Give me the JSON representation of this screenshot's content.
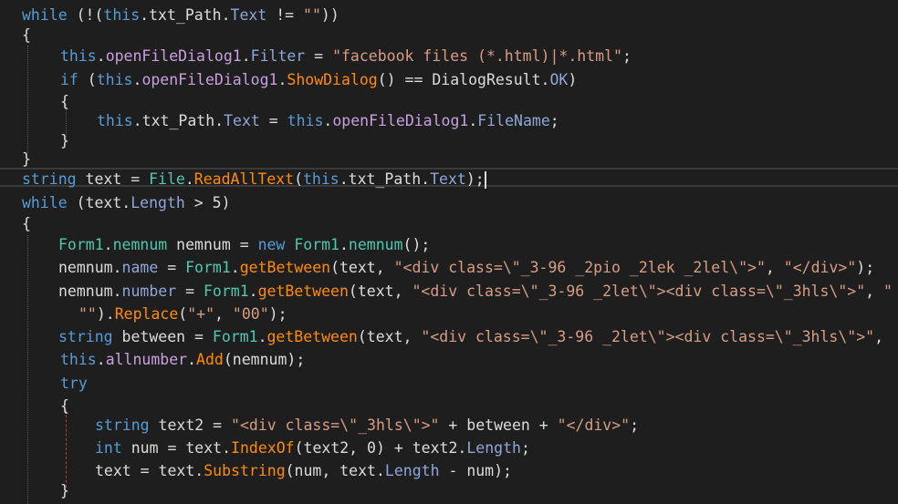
{
  "editor": {
    "lines": [
      {
        "indent": 24,
        "tokens": [
          {
            "t": "while",
            "c": "kw"
          },
          {
            "t": " (!(",
            "c": "pl"
          },
          {
            "t": "this",
            "c": "kw"
          },
          {
            "t": ".txt_Path.",
            "c": "pl"
          },
          {
            "t": "Text",
            "c": "pr"
          },
          {
            "t": " != ",
            "c": "pl"
          },
          {
            "t": "\"\"",
            "c": "st"
          },
          {
            "t": "))",
            "c": "pl"
          }
        ]
      },
      {
        "indent": 24,
        "tokens": [
          {
            "t": "{",
            "c": "pl"
          }
        ]
      },
      {
        "indent": 66,
        "tokens": [
          {
            "t": "this",
            "c": "kw"
          },
          {
            "t": ".",
            "c": "pl"
          },
          {
            "t": "openFileDialog1",
            "c": "fi"
          },
          {
            "t": ".",
            "c": "pl"
          },
          {
            "t": "Filter",
            "c": "pr"
          },
          {
            "t": " = ",
            "c": "pl"
          },
          {
            "t": "\"facebook files (*.html)|*.html\"",
            "c": "st"
          },
          {
            "t": ";",
            "c": "pl"
          }
        ]
      },
      {
        "indent": 66,
        "tokens": [
          {
            "t": "if",
            "c": "kw"
          },
          {
            "t": " (",
            "c": "pl"
          },
          {
            "t": "this",
            "c": "kw"
          },
          {
            "t": ".",
            "c": "pl"
          },
          {
            "t": "openFileDialog1",
            "c": "fi"
          },
          {
            "t": ".",
            "c": "pl"
          },
          {
            "t": "ShowDialog",
            "c": "me"
          },
          {
            "t": "() == DialogResult.",
            "c": "pl"
          },
          {
            "t": "OK",
            "c": "pr"
          },
          {
            "t": ")",
            "c": "pl"
          }
        ]
      },
      {
        "indent": 66,
        "tokens": [
          {
            "t": "{",
            "c": "pl"
          }
        ]
      },
      {
        "indent": 106,
        "tokens": [
          {
            "t": "this",
            "c": "kw"
          },
          {
            "t": ".txt_Path.",
            "c": "pl"
          },
          {
            "t": "Text",
            "c": "pr"
          },
          {
            "t": " = ",
            "c": "pl"
          },
          {
            "t": "this",
            "c": "kw"
          },
          {
            "t": ".",
            "c": "pl"
          },
          {
            "t": "openFileDialog1",
            "c": "fi"
          },
          {
            "t": ".",
            "c": "pl"
          },
          {
            "t": "FileName",
            "c": "pr"
          },
          {
            "t": ";",
            "c": "pl"
          }
        ]
      },
      {
        "indent": 66,
        "tokens": [
          {
            "t": "}",
            "c": "pl"
          }
        ]
      },
      {
        "indent": 24,
        "tokens": [
          {
            "t": "}",
            "c": "pl"
          }
        ]
      },
      {
        "indent": 24,
        "current": true,
        "tokens": [
          {
            "t": "string",
            "c": "kw"
          },
          {
            "t": " text = ",
            "c": "pl"
          },
          {
            "t": "File",
            "c": "ty"
          },
          {
            "t": ".",
            "c": "pl"
          },
          {
            "t": "ReadAllText",
            "c": "me"
          },
          {
            "t": "(",
            "c": "pl"
          },
          {
            "t": "this",
            "c": "kw"
          },
          {
            "t": ".txt_Path.",
            "c": "pl"
          },
          {
            "t": "Text",
            "c": "pr"
          },
          {
            "t": ");",
            "c": "pl"
          }
        ]
      },
      {
        "indent": 24,
        "tokens": [
          {
            "t": "while",
            "c": "kw"
          },
          {
            "t": " (text.",
            "c": "pl"
          },
          {
            "t": "Length",
            "c": "pr"
          },
          {
            "t": " > 5)",
            "c": "pl"
          }
        ]
      },
      {
        "indent": 24,
        "tokens": [
          {
            "t": "{",
            "c": "pl"
          }
        ]
      },
      {
        "indent": 64,
        "tokens": [
          {
            "t": "Form1",
            "c": "ty"
          },
          {
            "t": ".",
            "c": "pl"
          },
          {
            "t": "nemnum",
            "c": "ty"
          },
          {
            "t": " nemnum = ",
            "c": "pl"
          },
          {
            "t": "new",
            "c": "kw"
          },
          {
            "t": " ",
            "c": "pl"
          },
          {
            "t": "Form1",
            "c": "ty"
          },
          {
            "t": ".",
            "c": "pl"
          },
          {
            "t": "nemnum",
            "c": "ty"
          },
          {
            "t": "();",
            "c": "pl"
          }
        ]
      },
      {
        "indent": 64,
        "tokens": [
          {
            "t": "nemnum.",
            "c": "pl"
          },
          {
            "t": "name",
            "c": "pr"
          },
          {
            "t": " = ",
            "c": "pl"
          },
          {
            "t": "Form1",
            "c": "ty"
          },
          {
            "t": ".",
            "c": "pl"
          },
          {
            "t": "getBetween",
            "c": "me"
          },
          {
            "t": "(text, ",
            "c": "pl"
          },
          {
            "t": "\"<div class=\\\"_3-96 _2pio _2lek _2lel\\\">\"",
            "c": "st"
          },
          {
            "t": ", ",
            "c": "pl"
          },
          {
            "t": "\"</div>\"",
            "c": "st"
          },
          {
            "t": ");",
            "c": "pl"
          }
        ]
      },
      {
        "indent": 64,
        "tokens": [
          {
            "t": "nemnum.",
            "c": "pl"
          },
          {
            "t": "number",
            "c": "pr"
          },
          {
            "t": " = ",
            "c": "pl"
          },
          {
            "t": "Form1",
            "c": "ty"
          },
          {
            "t": ".",
            "c": "pl"
          },
          {
            "t": "getBetween",
            "c": "me"
          },
          {
            "t": "(text, ",
            "c": "pl"
          },
          {
            "t": "\"<div class=\\\"_3-96 _2let\\\"><div class=\\\"_3hls\\\">\"",
            "c": "st"
          },
          {
            "t": ", ",
            "c": "pl"
          },
          {
            "t": "\"",
            "c": "st"
          }
        ]
      },
      {
        "indent": 86,
        "tokens": [
          {
            "t": "\"\"",
            "c": "st"
          },
          {
            "t": ").",
            "c": "pl"
          },
          {
            "t": "Replace",
            "c": "me"
          },
          {
            "t": "(",
            "c": "pl"
          },
          {
            "t": "\"+\"",
            "c": "st"
          },
          {
            "t": ", ",
            "c": "pl"
          },
          {
            "t": "\"00\"",
            "c": "st"
          },
          {
            "t": ");",
            "c": "pl"
          }
        ]
      },
      {
        "indent": 64,
        "tokens": [
          {
            "t": "string",
            "c": "kw"
          },
          {
            "t": " between = ",
            "c": "pl"
          },
          {
            "t": "Form1",
            "c": "ty"
          },
          {
            "t": ".",
            "c": "pl"
          },
          {
            "t": "getBetween",
            "c": "me"
          },
          {
            "t": "(text, ",
            "c": "pl"
          },
          {
            "t": "\"<div class=\\\"_3-96 _2let\\\"><div class=\\\"_3hls\\\">\"",
            "c": "st"
          },
          {
            "t": ",",
            "c": "pl"
          }
        ]
      },
      {
        "indent": 66,
        "tokens": [
          {
            "t": "this",
            "c": "kw"
          },
          {
            "t": ".",
            "c": "pl"
          },
          {
            "t": "allnumber",
            "c": "fi"
          },
          {
            "t": ".",
            "c": "pl"
          },
          {
            "t": "Add",
            "c": "me"
          },
          {
            "t": "(nemnum);",
            "c": "pl"
          }
        ]
      },
      {
        "indent": 66,
        "tokens": [
          {
            "t": "try",
            "c": "kw"
          }
        ]
      },
      {
        "indent": 66,
        "tokens": [
          {
            "t": "{",
            "c": "pl"
          }
        ]
      },
      {
        "indent": 104,
        "tokens": [
          {
            "t": "string",
            "c": "kw"
          },
          {
            "t": " text2 = ",
            "c": "pl"
          },
          {
            "t": "\"<div class=\\\"_3hls\\\">\"",
            "c": "st"
          },
          {
            "t": " + between + ",
            "c": "pl"
          },
          {
            "t": "\"</div>\"",
            "c": "st"
          },
          {
            "t": ";",
            "c": "pl"
          }
        ]
      },
      {
        "indent": 104,
        "tokens": [
          {
            "t": "int",
            "c": "kw"
          },
          {
            "t": " num = text.",
            "c": "pl"
          },
          {
            "t": "IndexOf",
            "c": "me"
          },
          {
            "t": "(text2, 0) + text2.",
            "c": "pl"
          },
          {
            "t": "Length",
            "c": "pr"
          },
          {
            "t": ";",
            "c": "pl"
          }
        ]
      },
      {
        "indent": 104,
        "tokens": [
          {
            "t": "text = text.",
            "c": "pl"
          },
          {
            "t": "Substring",
            "c": "me"
          },
          {
            "t": "(num, text.",
            "c": "pl"
          },
          {
            "t": "Length",
            "c": "pr"
          },
          {
            "t": " - num);",
            "c": "pl"
          }
        ]
      },
      {
        "indent": 66,
        "tokens": [
          {
            "t": "}",
            "c": "pl"
          }
        ]
      }
    ]
  }
}
